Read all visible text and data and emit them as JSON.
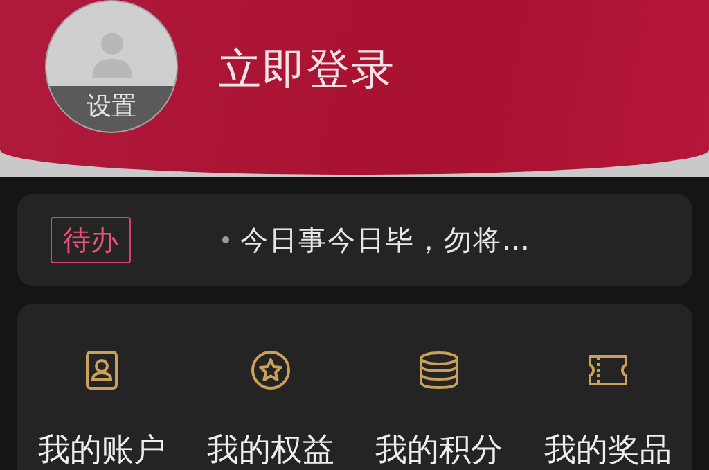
{
  "header": {
    "avatar_label": "设置",
    "login": "立即登录"
  },
  "todo": {
    "tag": "待办",
    "text": "今日事今日毕，勿将…"
  },
  "menu": [
    {
      "kind": "account",
      "label": "我的账户"
    },
    {
      "kind": "benefits",
      "label": "我的权益"
    },
    {
      "kind": "points",
      "label": "我的积分"
    },
    {
      "kind": "prizes",
      "label": "我的奖品"
    }
  ]
}
